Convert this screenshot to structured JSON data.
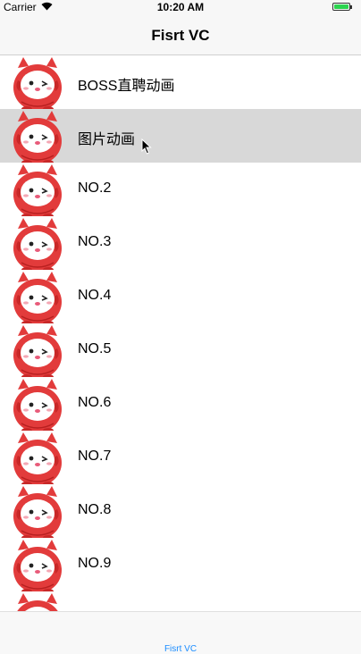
{
  "status_bar": {
    "carrier": "Carrier",
    "time": "10:20 AM",
    "battery_color": "#2bd44f"
  },
  "nav": {
    "title": "Fisrt VC"
  },
  "rows": [
    {
      "label": "BOSS直聘动画",
      "selected": false
    },
    {
      "label": "图片动画",
      "selected": true
    },
    {
      "label": "NO.2",
      "selected": false
    },
    {
      "label": "NO.3",
      "selected": false
    },
    {
      "label": "NO.4",
      "selected": false
    },
    {
      "label": "NO.5",
      "selected": false
    },
    {
      "label": "NO.6",
      "selected": false
    },
    {
      "label": "NO.7",
      "selected": false
    },
    {
      "label": "NO.8",
      "selected": false
    },
    {
      "label": "NO.9",
      "selected": false
    },
    {
      "label": "",
      "selected": false
    }
  ],
  "tab_bar": {
    "tab_label": "Fisrt VC",
    "accent": "#1a8cff"
  },
  "icons": {
    "row_avatar": "red-fluffy-mascot-icon",
    "cursor": "mouse-pointer-icon"
  }
}
